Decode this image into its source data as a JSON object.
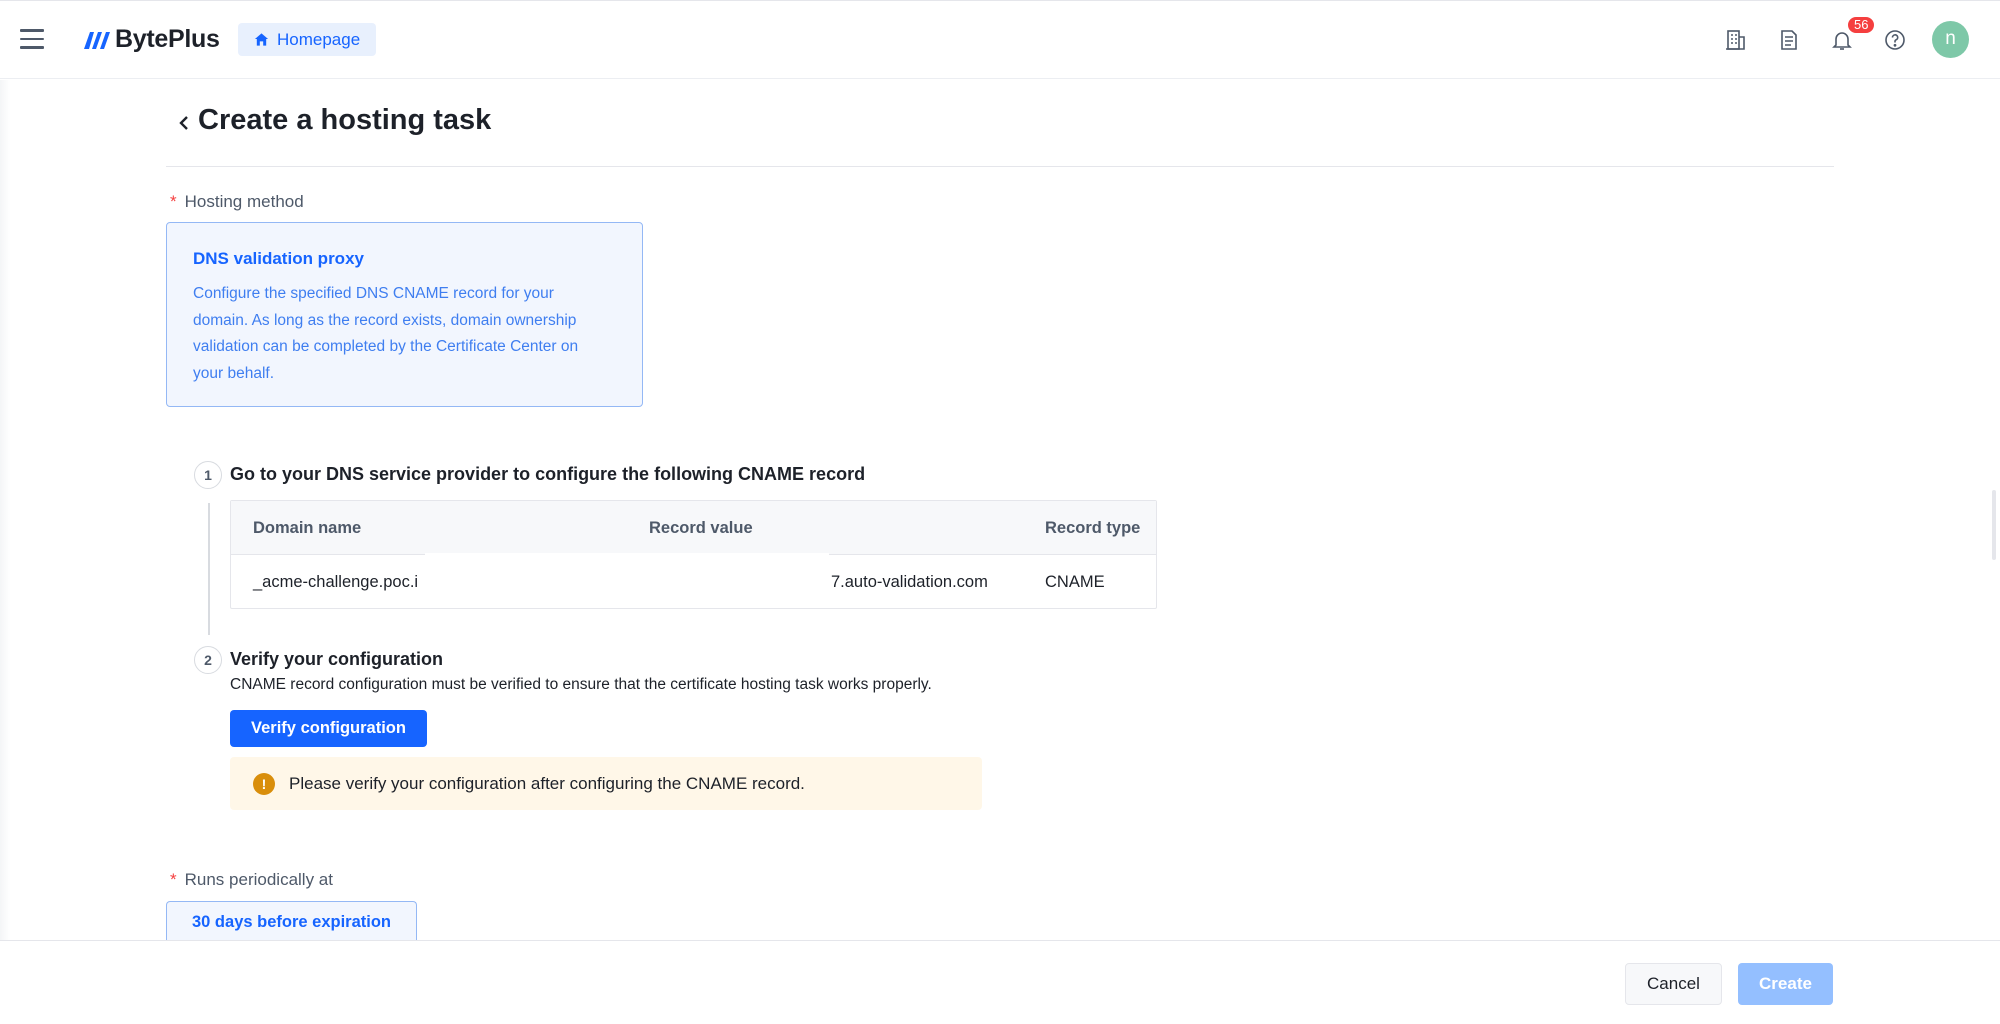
{
  "header": {
    "brand": "BytePlus",
    "home_label": "Homepage",
    "notification_count": "56",
    "avatar_letter": "n",
    "icons": [
      "menu-icon",
      "home-icon",
      "enterprise-icon",
      "document-icon",
      "bell-icon",
      "help-icon"
    ]
  },
  "page": {
    "title": "Create a hosting task"
  },
  "hosting_method": {
    "label": "Hosting method",
    "option_title": "DNS validation proxy",
    "option_desc_lines": [
      "Configure the specified DNS CNAME record for your",
      "domain. As long as the record exists, domain ownership",
      "validation can be completed by the Certificate Center on",
      "your behalf."
    ]
  },
  "step1": {
    "number": "1",
    "title": "Go to your DNS service provider to configure the following CNAME record",
    "columns": [
      "Domain name",
      "Record value",
      "Record type"
    ],
    "row": {
      "domain": "_acme-challenge.poc.i",
      "value": "7.auto-validation.com",
      "type": "CNAME"
    }
  },
  "step2": {
    "number": "2",
    "title": "Verify your configuration",
    "desc": "CNAME record configuration must be verified to ensure that the certificate hosting task works properly.",
    "button": "Verify configuration",
    "alert_icon": "!",
    "alert": "Please verify your configuration after configuring the CNAME record."
  },
  "schedule": {
    "label": "Runs periodically at",
    "option": "30 days before expiration"
  },
  "footer": {
    "cancel": "Cancel",
    "create": "Create"
  },
  "colors": {
    "primary": "#1664ff",
    "primary_disabled": "#94bfff",
    "warning": "#d98e0b",
    "danger": "#f53f3f",
    "selected_bg": "#f2f6fe"
  }
}
